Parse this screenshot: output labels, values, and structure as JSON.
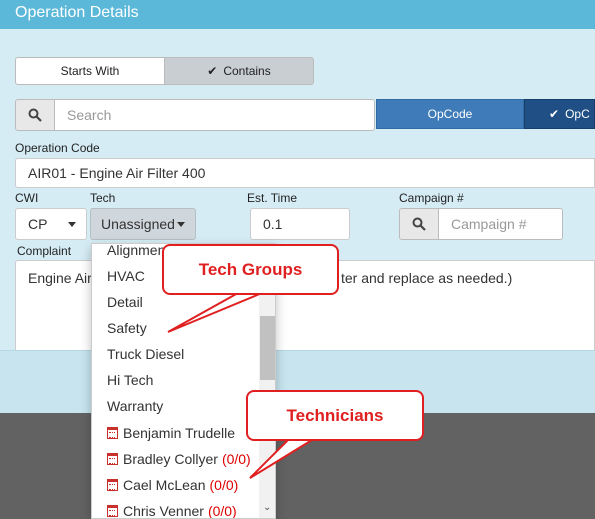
{
  "modal": {
    "title": "Operation Details"
  },
  "match_mode": {
    "starts_with": "Starts With",
    "contains": "Contains",
    "selected": "Contains"
  },
  "search": {
    "placeholder": "Search"
  },
  "buttons": {
    "opcode": "OpCode",
    "opc_partial": "OpC"
  },
  "operation_code": {
    "label": "Operation Code",
    "value": "AIR01 - Engine Air Filter 400"
  },
  "cwi": {
    "label": "CWI",
    "value": "CP"
  },
  "tech": {
    "label": "Tech",
    "value": "Unassigned"
  },
  "est_time": {
    "label": "Est. Time",
    "value": "0.1"
  },
  "campaign": {
    "label": "Campaign #",
    "placeholder": "Campaign #"
  },
  "complaint": {
    "label": "Complaint",
    "text_left": "Engine Air",
    "text_right": "ter and replace as needed.)"
  },
  "tech_dropdown": {
    "groups": [
      "Alignment",
      "HVAC",
      "Detail",
      "Safety",
      "Truck Diesel",
      "Hi Tech",
      "Warranty"
    ],
    "technicians": [
      {
        "name": "Benjamin Trudelle",
        "count": ""
      },
      {
        "name": "Bradley Collyer",
        "count": "(0/0)"
      },
      {
        "name": "Cael McLean",
        "count": "(0/0)"
      },
      {
        "name": "Chris Venner",
        "count": "(0/0)"
      }
    ]
  },
  "annotations": {
    "tech_groups": "Tech Groups",
    "technicians": "Technicians"
  },
  "colors": {
    "header": "#5cb8d8",
    "modal_bg": "#d6ecf5",
    "opcode_btn": "#3f7bb8",
    "callout": "#e02020"
  }
}
